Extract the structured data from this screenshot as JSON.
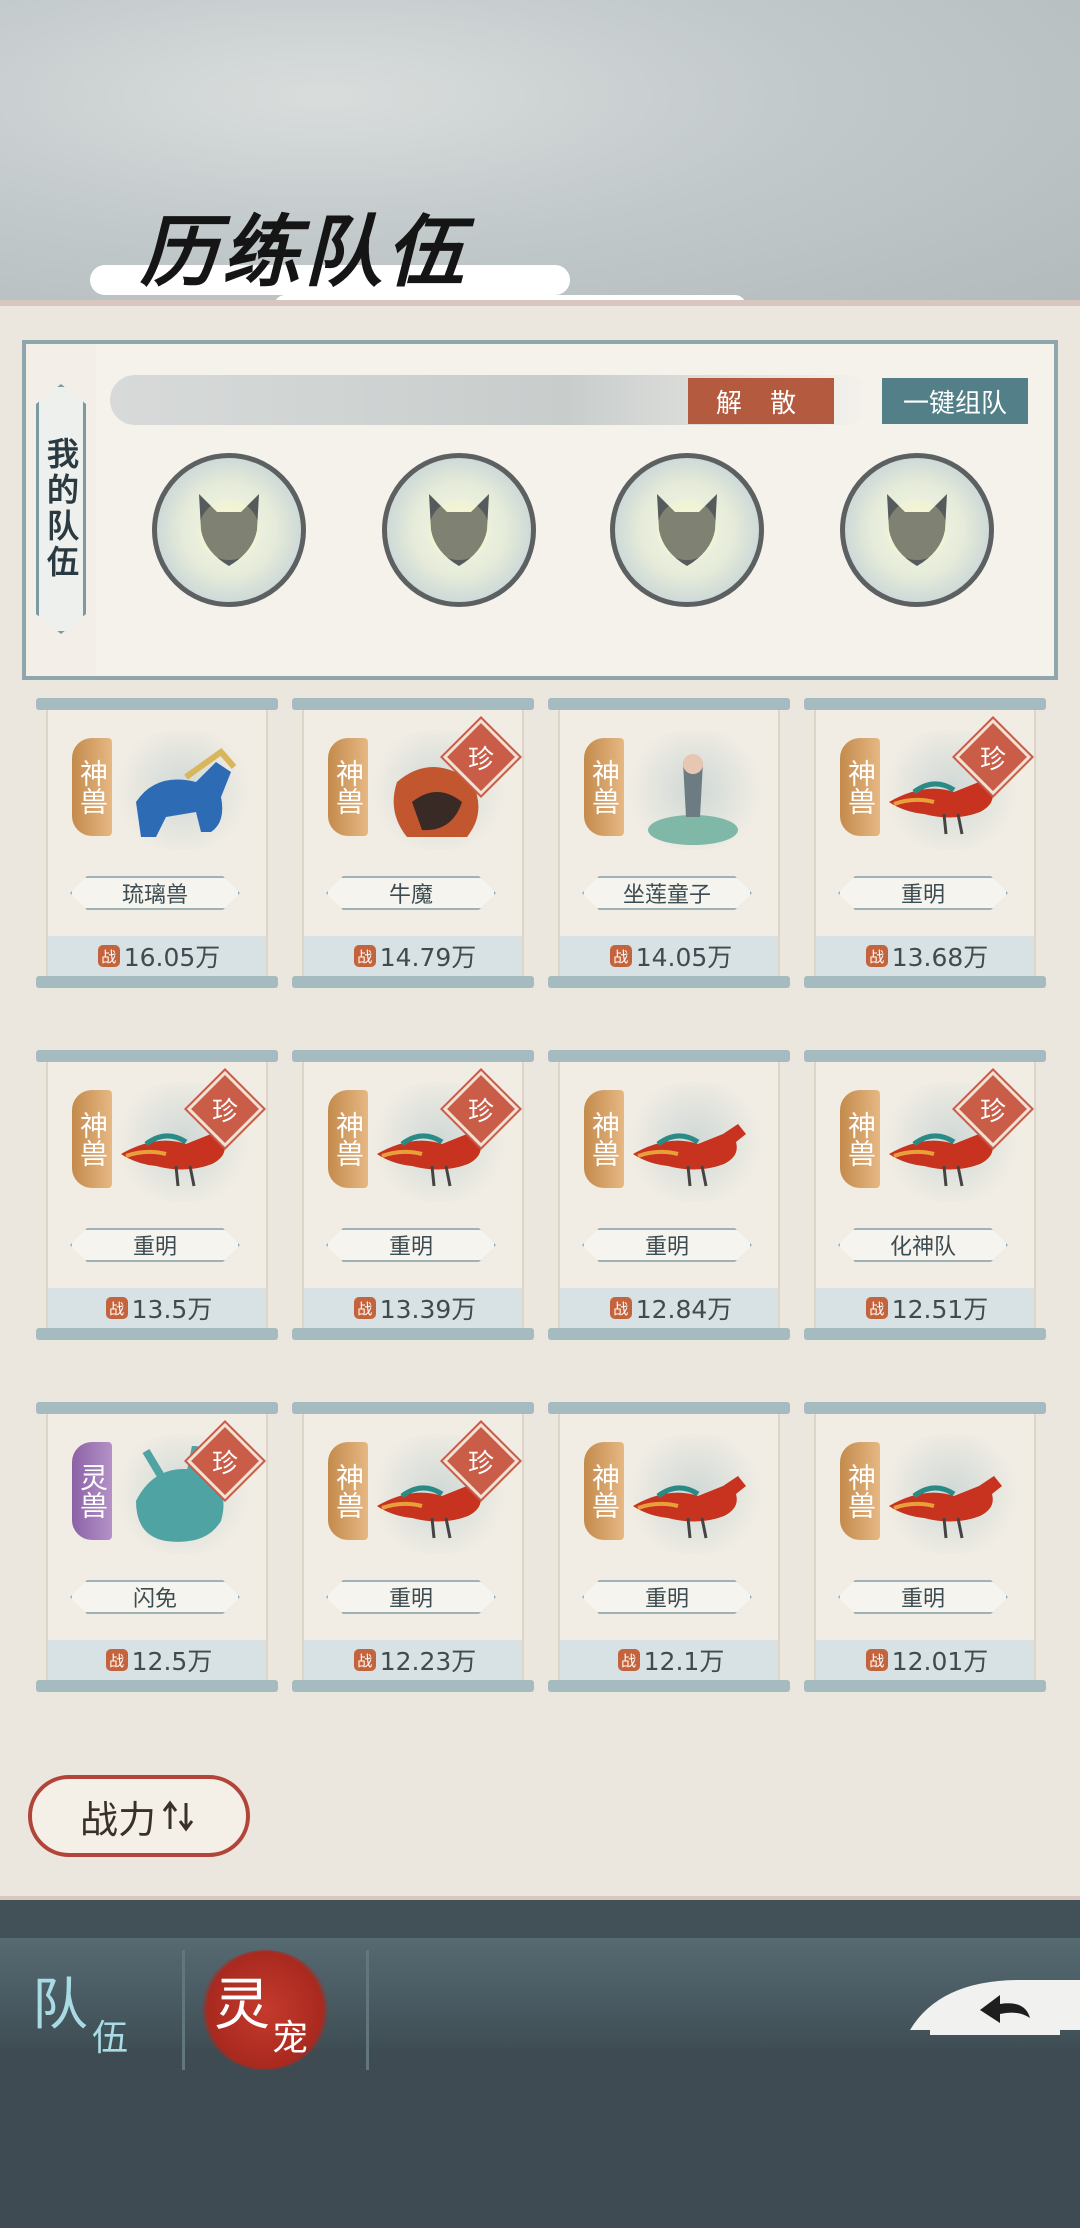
{
  "header": {
    "title": "历练队伍"
  },
  "team": {
    "label": "我的队伍",
    "disband_label": "解 散",
    "auto_team_label": "一键组队",
    "slots": [
      {
        "icon": "empty-fox-slot-icon"
      },
      {
        "icon": "empty-fox-slot-icon"
      },
      {
        "icon": "empty-fox-slot-icon"
      },
      {
        "icon": "empty-fox-slot-icon"
      }
    ]
  },
  "pets": [
    {
      "grade": "神兽",
      "rare": false,
      "name": "琉璃兽",
      "power": "16.05万",
      "creature": "blue-beast",
      "color": "#2e6bb5"
    },
    {
      "grade": "神兽",
      "rare": true,
      "name": "牛魔",
      "power": "14.79万",
      "creature": "bull-demon",
      "color": "#c2562e"
    },
    {
      "grade": "神兽",
      "rare": false,
      "name": "坐莲童子",
      "power": "14.05万",
      "creature": "lotus-child",
      "color": "#7fb8a6"
    },
    {
      "grade": "神兽",
      "rare": true,
      "name": "重明",
      "power": "13.68万",
      "creature": "phoenix-bird",
      "color": "#c8331f"
    },
    {
      "grade": "神兽",
      "rare": true,
      "name": "重明",
      "power": "13.5万",
      "creature": "phoenix-bird",
      "color": "#c8331f"
    },
    {
      "grade": "神兽",
      "rare": true,
      "name": "重明",
      "power": "13.39万",
      "creature": "phoenix-bird",
      "color": "#c8331f"
    },
    {
      "grade": "神兽",
      "rare": false,
      "name": "重明",
      "power": "12.84万",
      "creature": "phoenix-bird",
      "color": "#c8331f"
    },
    {
      "grade": "神兽",
      "rare": true,
      "name": "化神队",
      "power": "12.51万",
      "creature": "phoenix-bird",
      "color": "#c8331f"
    },
    {
      "grade": "灵兽",
      "rare": true,
      "name": "闪免",
      "power": "12.5万",
      "creature": "spirit-rabbit",
      "color": "#4fa3a3"
    },
    {
      "grade": "神兽",
      "rare": true,
      "name": "重明",
      "power": "12.23万",
      "creature": "phoenix-bird",
      "color": "#c8331f"
    },
    {
      "grade": "神兽",
      "rare": false,
      "name": "重明",
      "power": "12.1万",
      "creature": "phoenix-bird",
      "color": "#c8331f"
    },
    {
      "grade": "神兽",
      "rare": false,
      "name": "重明",
      "power": "12.01万",
      "creature": "phoenix-bird",
      "color": "#c8331f"
    }
  ],
  "rare_label": "珍",
  "power_icon_glyph": "战",
  "sort": {
    "label": "战力",
    "icon": "sort-arrows-icon"
  },
  "bottom_tabs": {
    "team": {
      "main": "队",
      "sub": "伍"
    },
    "pet": {
      "main": "灵",
      "sub": "宠"
    }
  }
}
